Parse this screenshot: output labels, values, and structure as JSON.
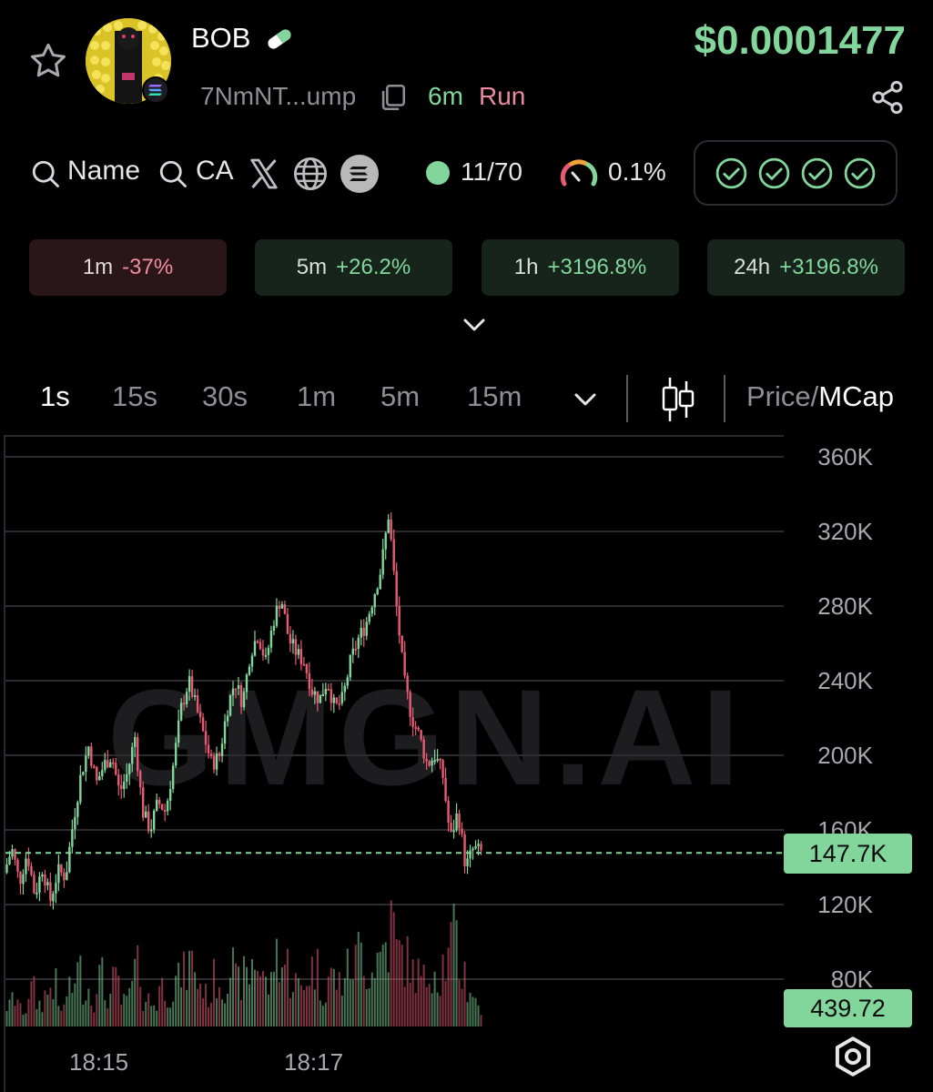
{
  "header": {
    "token_name": "BOB",
    "price": "$0.0001477",
    "address": "7NmNT...ump",
    "age": "6m",
    "status": "Run"
  },
  "links": {
    "name_label": "Name",
    "ca_label": "CA",
    "holders": "11/70",
    "tax": "0.1%"
  },
  "changes": [
    {
      "label": "1m",
      "value": "-37%"
    },
    {
      "label": "5m",
      "value": "+26.2%"
    },
    {
      "label": "1h",
      "value": "+3196.8%"
    },
    {
      "label": "24h",
      "value": "+3196.8%"
    }
  ],
  "timeframes": [
    "1s",
    "15s",
    "30s",
    "1m",
    "5m",
    "15m"
  ],
  "active_timeframe": "1s",
  "price_toggle": {
    "price": "Price/",
    "mcap": "MCap"
  },
  "colors": {
    "up": "#82d69b",
    "down": "#e95b74",
    "background": "#000000"
  },
  "icons": [
    "star-icon",
    "solana-icon",
    "pill-icon",
    "copy-icon",
    "share-icon",
    "search-icon",
    "x-icon",
    "globe-icon",
    "gauge-icon",
    "check-circle-icon",
    "chevron-down-icon",
    "candlestick-icon",
    "settings-icon"
  ],
  "chart_data": {
    "type": "candlestick",
    "watermark": "GMGN.AI",
    "y_ticks": [
      "360K",
      "320K",
      "280K",
      "240K",
      "200K",
      "160K",
      "120K",
      "80K"
    ],
    "ylim": [
      80000,
      360000
    ],
    "x_ticks": [
      "18:15",
      "18:17"
    ],
    "current_value_label": "147.7K",
    "current_value": 147700,
    "volume_label": "439.72",
    "path": [
      137000,
      150000,
      132000,
      148000,
      125000,
      140000,
      122000,
      138000,
      135000,
      165000,
      190000,
      205000,
      185000,
      195000,
      200000,
      180000,
      190000,
      210000,
      170000,
      160000,
      175000,
      170000,
      195000,
      225000,
      240000,
      225000,
      210000,
      195000,
      200000,
      225000,
      240000,
      228000,
      255000,
      265000,
      250000,
      272000,
      285000,
      262000,
      255000,
      250000,
      235000,
      230000,
      240000,
      225000,
      230000,
      250000,
      262000,
      270000,
      285000,
      300000,
      330000,
      280000,
      240000,
      220000,
      210000,
      195000,
      200000,
      190000,
      155000,
      170000,
      140000,
      150000,
      148000
    ],
    "volume": [
      22,
      30,
      18,
      40,
      25,
      35,
      45,
      20,
      38,
      60,
      42,
      28,
      55,
      33,
      48,
      26,
      40,
      62,
      30,
      25,
      44,
      36,
      50,
      58,
      70,
      46,
      34,
      52,
      40,
      65,
      48,
      55,
      72,
      60,
      45,
      80,
      68,
      50,
      42,
      58,
      64,
      40,
      55,
      48,
      62,
      70,
      85,
      60,
      75,
      90,
      110,
      80,
      72,
      58,
      50,
      66,
      55,
      70,
      95,
      60,
      40,
      25,
      18
    ]
  }
}
